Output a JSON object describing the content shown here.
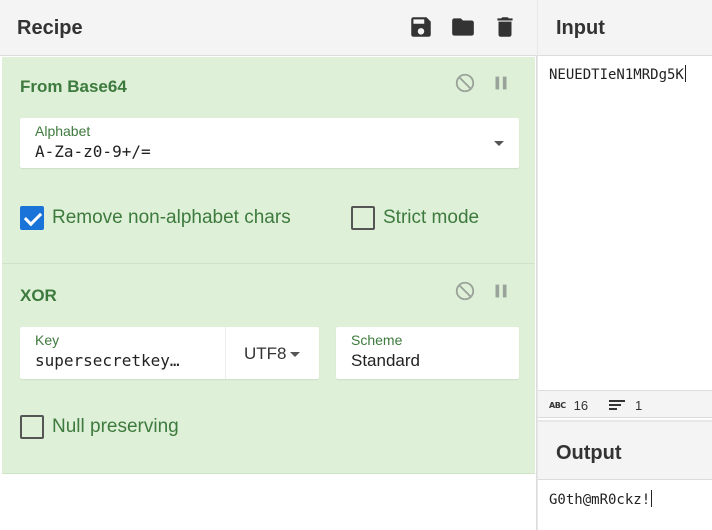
{
  "recipe": {
    "title": "Recipe",
    "icons": [
      "save-icon",
      "folder-icon",
      "trash-icon"
    ],
    "operations": [
      {
        "title": "From Base64",
        "alphabet": {
          "label": "Alphabet",
          "value": "A-Za-z0-9+/="
        },
        "remove_non_alphabet": {
          "label": "Remove non-alphabet chars",
          "checked": true
        },
        "strict_mode": {
          "label": "Strict mode",
          "checked": false
        }
      },
      {
        "title": "XOR",
        "key": {
          "label": "Key",
          "value": "supersecretkey…",
          "encoding": "UTF8"
        },
        "scheme": {
          "label": "Scheme",
          "value": "Standard"
        },
        "null_preserving": {
          "label": "Null preserving",
          "checked": false
        }
      }
    ]
  },
  "input": {
    "title": "Input",
    "text": "NEUEDTIeN1MRDg5K",
    "stats": {
      "length_icon": "ABC",
      "length": "16",
      "lines": "1"
    }
  },
  "output": {
    "title": "Output",
    "text": "G0th@mR0ckz!"
  },
  "colors": {
    "op_background": "#dff0d8",
    "op_text": "#3d7a3d",
    "checkbox_checked": "#1a73d9"
  }
}
